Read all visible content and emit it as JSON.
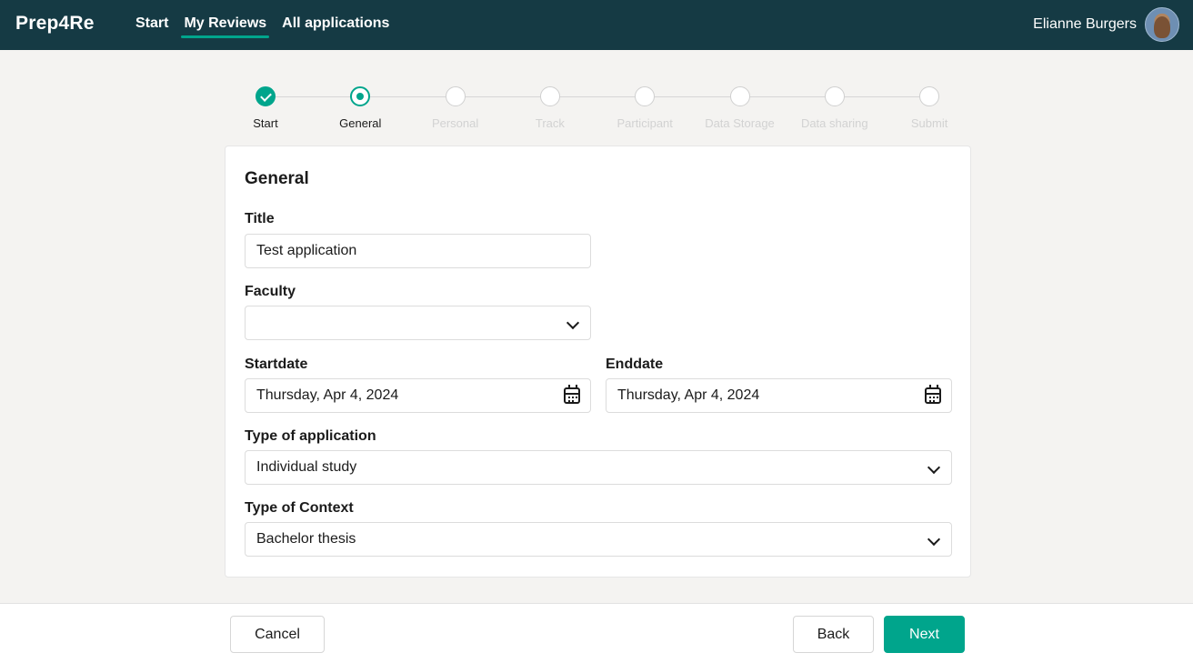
{
  "header": {
    "brand": "Prep4Re",
    "nav": [
      {
        "label": "Start",
        "active": false
      },
      {
        "label": "My Reviews",
        "active": true
      },
      {
        "label": "All applications",
        "active": false
      }
    ],
    "user_name": "Elianne Burgers"
  },
  "stepper": {
    "steps": [
      {
        "label": "Start",
        "state": "done"
      },
      {
        "label": "General",
        "state": "current"
      },
      {
        "label": "Personal",
        "state": "todo"
      },
      {
        "label": "Track",
        "state": "todo"
      },
      {
        "label": "Participant",
        "state": "todo"
      },
      {
        "label": "Data Storage",
        "state": "todo"
      },
      {
        "label": "Data sharing",
        "state": "todo"
      },
      {
        "label": "Submit",
        "state": "todo"
      }
    ]
  },
  "form": {
    "heading": "General",
    "title_label": "Title",
    "title_value": "Test application",
    "faculty_label": "Faculty",
    "faculty_value": "",
    "startdate_label": "Startdate",
    "startdate_value": "Thursday, Apr 4, 2024",
    "enddate_label": "Enddate",
    "enddate_value": "Thursday, Apr 4, 2024",
    "type_app_label": "Type of application",
    "type_app_value": "Individual study",
    "type_context_label": "Type of Context",
    "type_context_value": "Bachelor thesis"
  },
  "footer": {
    "cancel_label": "Cancel",
    "back_label": "Back",
    "next_label": "Next"
  },
  "colors": {
    "header_bg": "#153a44",
    "accent": "#00a58c",
    "page_bg": "#f4f3f1"
  }
}
